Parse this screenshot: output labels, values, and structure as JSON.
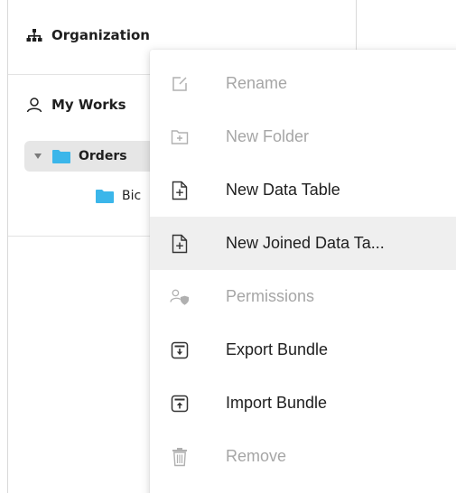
{
  "sidebar": {
    "organization_label": "Organization",
    "workspace_label": "My Works",
    "tree": {
      "selected_folder": "Orders",
      "child_folder": "Bic"
    }
  },
  "context_menu": {
    "items": [
      {
        "label": "Rename",
        "icon": "rename-icon",
        "enabled": false
      },
      {
        "label": "New Folder",
        "icon": "new-folder-icon",
        "enabled": false
      },
      {
        "label": "New Data Table",
        "icon": "new-data-table-icon",
        "enabled": true
      },
      {
        "label": "New Joined Data Ta...",
        "icon": "new-joined-data-table-icon",
        "enabled": true,
        "hovered": true
      },
      {
        "label": "Permissions",
        "icon": "permissions-icon",
        "enabled": false
      },
      {
        "label": "Export Bundle",
        "icon": "export-bundle-icon",
        "enabled": true
      },
      {
        "label": "Import Bundle",
        "icon": "import-bundle-icon",
        "enabled": true
      },
      {
        "label": "Remove",
        "icon": "trash-icon",
        "enabled": false
      }
    ]
  },
  "colors": {
    "folder": "#3bb6ea",
    "selected_row_bg": "#e6e6e6",
    "hover_bg": "#efefef",
    "disabled_text": "#a6a6a6",
    "text": "#202020"
  }
}
